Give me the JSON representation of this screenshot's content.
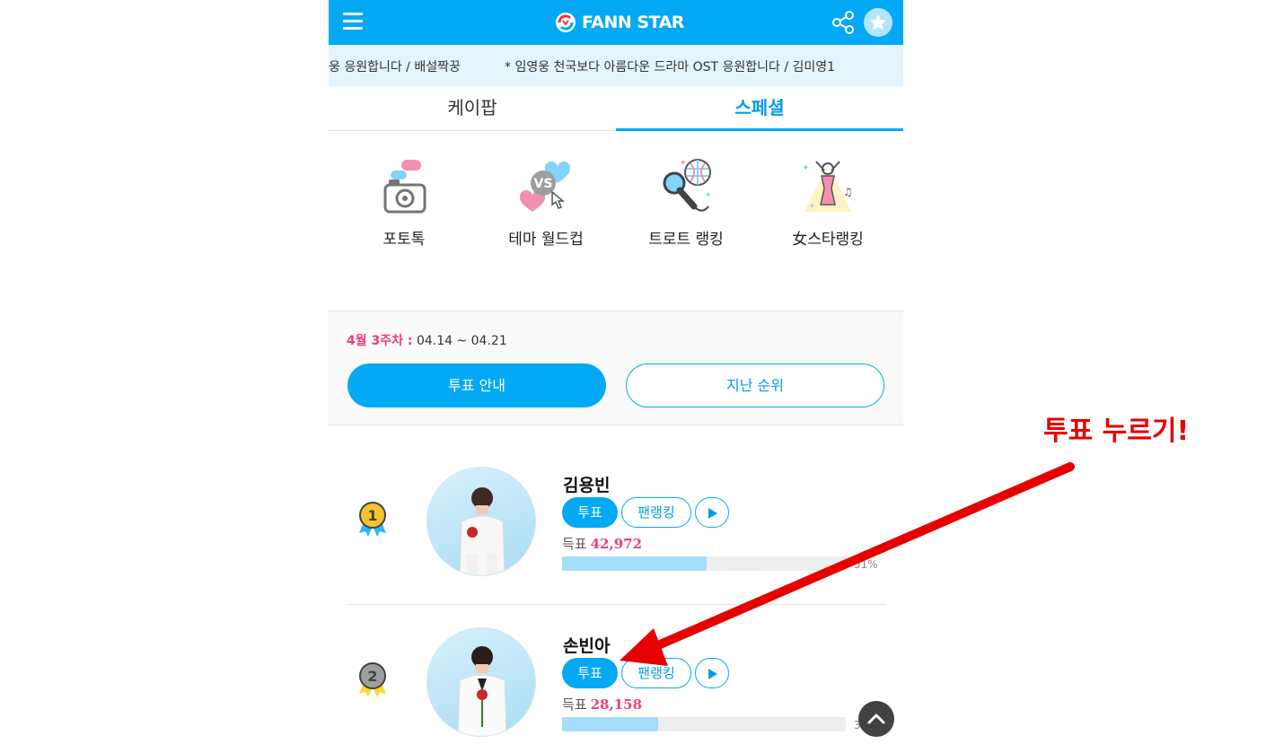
{
  "header": {
    "logo_text": "FANN STAR",
    "brand_color": "#03a9f4",
    "icons": [
      "menu-icon",
      "share-icon",
      "star-icon"
    ]
  },
  "ticker": {
    "left_text": "웅 응원합니다 / 배설짝꿍",
    "right_text": "* 임영웅 천국보다 아름다운 드라마 OST 응원합니다 / 김미영1"
  },
  "tabs": [
    {
      "label": "케이팝",
      "active": false
    },
    {
      "label": "스페셜",
      "active": true
    }
  ],
  "menus": [
    {
      "label": "포토톡",
      "icon": "camera-chat-icon"
    },
    {
      "label": "테마 월드컵",
      "icon": "vs-hearts-icon"
    },
    {
      "label": "트로트 랭킹",
      "icon": "microphone-disco-icon"
    },
    {
      "label": "女스타랭킹",
      "icon": "female-star-icon"
    }
  ],
  "week": {
    "label": "4월 3주차 :",
    "range": "04.14 ~ 04.21",
    "guide_button": "투표 안내",
    "past_button": "지난 순위"
  },
  "ranking": [
    {
      "rank": "1",
      "name": "김용빈",
      "vote_label": "투표",
      "fan_label": "팬랭킹",
      "votes_label": "득표",
      "votes": "42,972",
      "percent_text": "51%",
      "percent": 51,
      "medal_color": "#f4c430"
    },
    {
      "rank": "2",
      "name": "손빈아",
      "vote_label": "투표",
      "fan_label": "팬랭킹",
      "votes_label": "득표",
      "votes": "28,158",
      "percent_text": "34%",
      "percent": 34,
      "medal_color": "#9e9e9e"
    }
  ],
  "annotation": {
    "text": "투표 누르기!",
    "color": "#e60000"
  }
}
